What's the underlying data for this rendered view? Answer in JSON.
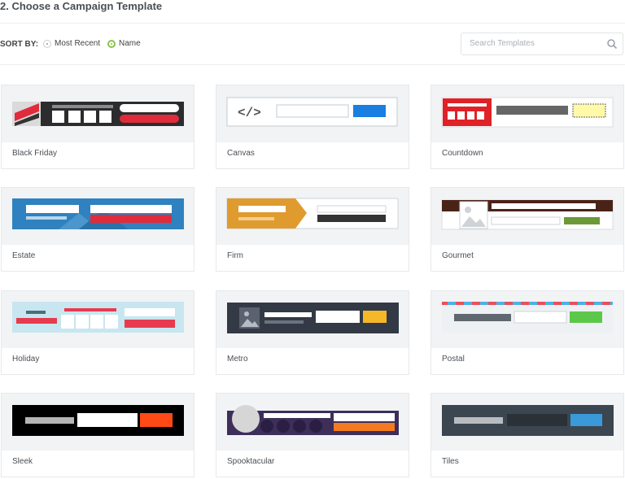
{
  "page": {
    "title": "2. Choose a Campaign Template"
  },
  "sort": {
    "label": "SORT BY:",
    "options": [
      {
        "label": "Most Recent",
        "selected": false
      },
      {
        "label": "Name",
        "selected": true
      }
    ]
  },
  "search": {
    "placeholder": "Search Templates",
    "icon": "search-icon"
  },
  "colors": {
    "accent_green": "#8bc34a"
  },
  "templates": [
    {
      "name": "Black Friday"
    },
    {
      "name": "Canvas"
    },
    {
      "name": "Countdown"
    },
    {
      "name": "Estate"
    },
    {
      "name": "Firm"
    },
    {
      "name": "Gourmet"
    },
    {
      "name": "Holiday"
    },
    {
      "name": "Metro"
    },
    {
      "name": "Postal"
    },
    {
      "name": "Sleek"
    },
    {
      "name": "Spooktacular"
    },
    {
      "name": "Tiles"
    }
  ]
}
